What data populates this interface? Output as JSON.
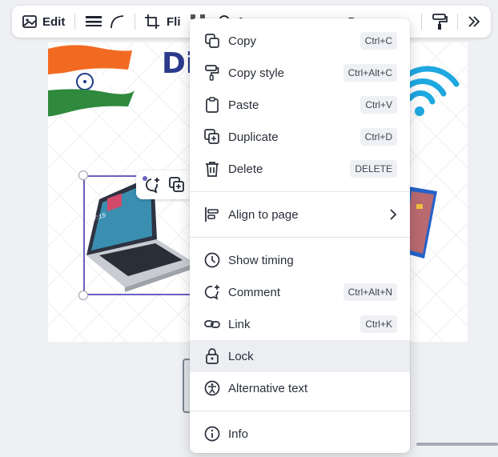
{
  "toolbar": {
    "edit_label": "Edit",
    "flip_label": "Fli",
    "arrange_label": "A",
    "position_label": "P"
  },
  "canvas": {
    "heading_text": "Di"
  },
  "menu": {
    "items": [
      {
        "label": "Copy",
        "shortcut": "Ctrl+C"
      },
      {
        "label": "Copy style",
        "shortcut": "Ctrl+Alt+C"
      },
      {
        "label": "Paste",
        "shortcut": "Ctrl+V"
      },
      {
        "label": "Duplicate",
        "shortcut": "Ctrl+D"
      },
      {
        "label": "Delete",
        "shortcut": "DELETE"
      },
      {
        "label": "Align to page"
      },
      {
        "label": "Show timing"
      },
      {
        "label": "Comment",
        "shortcut": "Ctrl+Alt+N"
      },
      {
        "label": "Link",
        "shortcut": "Ctrl+K"
      },
      {
        "label": "Lock"
      },
      {
        "label": "Alternative text"
      },
      {
        "label": "Info"
      }
    ]
  },
  "laptop_screen_time": "17:15",
  "colors": {
    "accent": "#6a5fc1",
    "heading": "#2b3a8c",
    "wifi": "#1fa8e0"
  }
}
